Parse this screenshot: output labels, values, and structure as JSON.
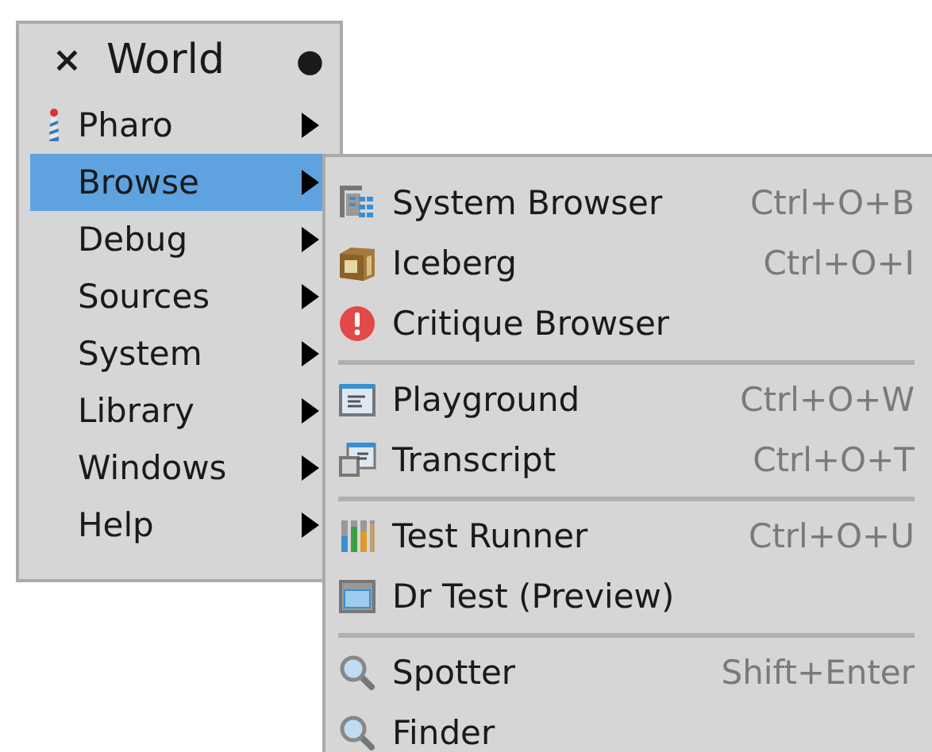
{
  "world_menu": {
    "close": "×",
    "title": "World",
    "pin": "●",
    "items": [
      {
        "label": "Pharo",
        "kind": "lighthouse",
        "has_submenu": true,
        "selected": false
      },
      {
        "label": "Browse",
        "has_submenu": true,
        "selected": true
      },
      {
        "label": "Debug",
        "has_submenu": true,
        "selected": false
      },
      {
        "label": "Sources",
        "has_submenu": true,
        "selected": false
      },
      {
        "label": "System",
        "has_submenu": true,
        "selected": false
      },
      {
        "label": "Library",
        "has_submenu": true,
        "selected": false
      },
      {
        "label": "Windows",
        "has_submenu": true,
        "selected": false
      },
      {
        "label": "Help",
        "has_submenu": true,
        "selected": false
      }
    ]
  },
  "browse_submenu": {
    "groups": [
      [
        {
          "label": "System Browser",
          "kind": "browser",
          "shortcut": "Ctrl+O+B"
        },
        {
          "label": "Iceberg",
          "kind": "box",
          "shortcut": "Ctrl+O+I"
        },
        {
          "label": "Critique Browser",
          "kind": "warning"
        }
      ],
      [
        {
          "label": "Playground",
          "kind": "window-text",
          "shortcut": "Ctrl+O+W"
        },
        {
          "label": "Transcript",
          "kind": "windows",
          "shortcut": "Ctrl+O+T"
        }
      ],
      [
        {
          "label": "Test Runner",
          "kind": "bars",
          "shortcut": "Ctrl+O+U"
        },
        {
          "label": "Dr Test (Preview)",
          "kind": "window"
        }
      ],
      [
        {
          "label": "Spotter",
          "kind": "search",
          "shortcut": "Shift+Enter"
        },
        {
          "label": "Finder",
          "kind": "search"
        }
      ]
    ]
  }
}
